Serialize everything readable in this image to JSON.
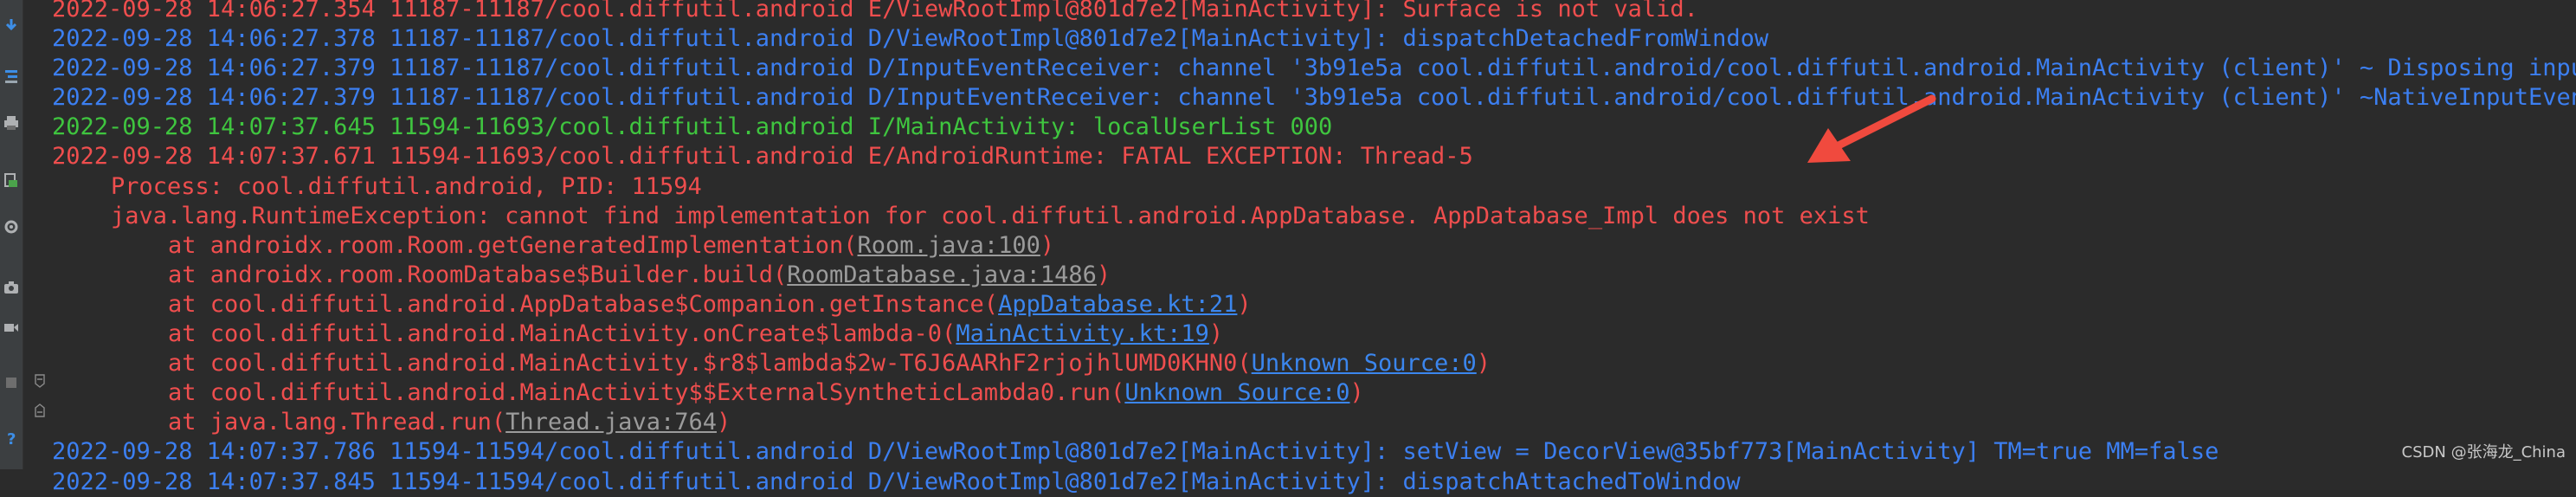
{
  "colors": {
    "background": "#2b2b2b",
    "debug": "#3c7ff1",
    "info": "#3fc53f",
    "error": "#ef4e4e",
    "link_gray": "#9b9b9b",
    "link_blue": "#3b86ee",
    "arrow": "#f04a3e"
  },
  "gutter_icons": [
    "download-icon",
    "filter-icon",
    "print-icon",
    "restart-icon",
    "settings-icon",
    "camera-icon",
    "video-icon",
    "layout-icon",
    "help-icon"
  ],
  "log": {
    "header_lines": [
      {
        "level": "E",
        "text": "2022-09-28 14:06:27.354 11187-11187/cool.diffutil.android E/ViewRootImpl@801d7e2[MainActivity]: Surface is not valid."
      },
      {
        "level": "D",
        "text": "2022-09-28 14:06:27.378 11187-11187/cool.diffutil.android D/ViewRootImpl@801d7e2[MainActivity]: dispatchDetachedFromWindow"
      },
      {
        "level": "D",
        "text": "2022-09-28 14:06:27.379 11187-11187/cool.diffutil.android D/InputEventReceiver: channel '3b91e5a cool.diffutil.android/cool.diffutil.android.MainActivity (client)' ~ Disposing input event receiver."
      },
      {
        "level": "D",
        "text": "2022-09-28 14:06:27.379 11187-11187/cool.diffutil.android D/InputEventReceiver: channel '3b91e5a cool.diffutil.android/cool.diffutil.android.MainActivity (client)' ~NativeInputEventReceiver."
      },
      {
        "level": "I",
        "text": "2022-09-28 14:07:37.645 11594-11693/cool.diffutil.android I/MainActivity: localUserList 000"
      },
      {
        "level": "E",
        "text": "2022-09-28 14:07:37.671 11594-11693/cool.diffutil.android E/AndroidRuntime: FATAL EXCEPTION: Thread-5"
      }
    ],
    "process_line": "Process: cool.diffutil.android, PID: 11594",
    "exception_line": "java.lang.RuntimeException: cannot find implementation for cool.diffutil.android.AppDatabase. AppDatabase_Impl does not exist",
    "stack": [
      {
        "prefix": "at androidx.room.Room.getGeneratedImplementation(",
        "link": "Room.java:100",
        "link_style": "gray",
        "suffix": ")"
      },
      {
        "prefix": "at androidx.room.RoomDatabase$Builder.build(",
        "link": "RoomDatabase.java:1486",
        "link_style": "gray",
        "suffix": ")"
      },
      {
        "prefix": "at cool.diffutil.android.AppDatabase$Companion.getInstance(",
        "link": "AppDatabase.kt:21",
        "link_style": "blue",
        "suffix": ")"
      },
      {
        "prefix": "at cool.diffutil.android.MainActivity.onCreate$lambda-0(",
        "link": "MainActivity.kt:19",
        "link_style": "blue",
        "suffix": ")"
      },
      {
        "prefix": "at cool.diffutil.android.MainActivity.$r8$lambda$2w-T6J6AARhF2rjojhlUMD0KHN0(",
        "link": "Unknown Source:0",
        "link_style": "blue",
        "suffix": ")"
      },
      {
        "prefix": "at cool.diffutil.android.MainActivity$$ExternalSyntheticLambda0.run(",
        "link": "Unknown Source:0",
        "link_style": "blue",
        "suffix": ")"
      },
      {
        "prefix": "at java.lang.Thread.run(",
        "link": "Thread.java:764",
        "link_style": "gray",
        "suffix": ")"
      }
    ],
    "footer_lines": [
      {
        "level": "D",
        "text": "2022-09-28 14:07:37.786 11594-11594/cool.diffutil.android D/ViewRootImpl@801d7e2[MainActivity]: setView = DecorView@35bf773[MainActivity] TM=true MM=false"
      },
      {
        "level": "D",
        "text": "2022-09-28 14:07:37.845 11594-11594/cool.diffutil.android D/ViewRootImpl@801d7e2[MainActivity]: dispatchAttachedToWindow"
      }
    ]
  },
  "watermark": "CSDN @张海龙_China"
}
